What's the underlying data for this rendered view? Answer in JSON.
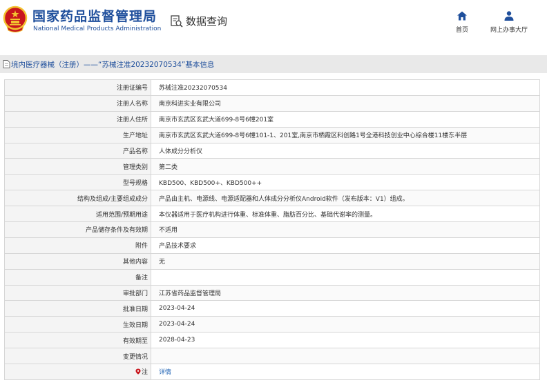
{
  "header": {
    "brand_cn": "国家药品监督管理局",
    "brand_en": "National Medical Products Administration",
    "query_label": "数据查询",
    "nav": {
      "home": "首页",
      "service": "网上办事大厅"
    }
  },
  "banner": {
    "title": "境内医疗器械（注册）——“苏械注准20232070534”基本信息"
  },
  "rows": [
    {
      "key": "注册证编号",
      "value": "苏械注准20232070534"
    },
    {
      "key": "注册人名称",
      "value": "南京科进实业有限公司"
    },
    {
      "key": "注册人住所",
      "value": "南京市玄武区玄武大道699-8号6幢201室"
    },
    {
      "key": "生产地址",
      "value": "南京市玄武区玄武大道699-8号6幢101-1、201室,南京市栖霞区科创路1号全港科技创业中心综合楼11楼东半层"
    },
    {
      "key": "产品名称",
      "value": "人体成分分析仪"
    },
    {
      "key": "管理类别",
      "value": "第二类"
    },
    {
      "key": "型号规格",
      "value": "KBD500、KBD500+、KBD500++"
    },
    {
      "key": "结构及组成/主要组成成分",
      "value": "产品由主机、电源线、电源适配器和人体成分分析仪Android软件（发布版本：V1）组成。"
    },
    {
      "key": "适用范围/预期用途",
      "value": "本仪器适用于医疗机构进行体重、标准体重、脂肪百分比、基础代谢率的测量。"
    },
    {
      "key": "产品储存条件及有效期",
      "value": "不适用"
    },
    {
      "key": "附件",
      "value": "产品技术要求"
    },
    {
      "key": "其他内容",
      "value": "无"
    },
    {
      "key": "备注",
      "value": ""
    },
    {
      "key": "审批部门",
      "value": "江苏省药品监督管理局"
    },
    {
      "key": "批准日期",
      "value": "2023-04-24"
    },
    {
      "key": "生效日期",
      "value": "2023-04-24"
    },
    {
      "key": "有效期至",
      "value": "2028-04-23"
    },
    {
      "key": "变更情况",
      "value": ""
    }
  ],
  "note": {
    "key": "注",
    "link": "详情"
  },
  "colors": {
    "brand_blue": "#1f4f9c",
    "link_blue": "#1f63b4",
    "emblem_red": "#c8161d",
    "emblem_gold": "#f2c230"
  },
  "icons": {
    "emblem": "national-emblem-icon",
    "query": "search-document-icon",
    "home": "home-icon",
    "service": "user-icon",
    "banner": "document-icon",
    "note": "location-pin-icon"
  }
}
